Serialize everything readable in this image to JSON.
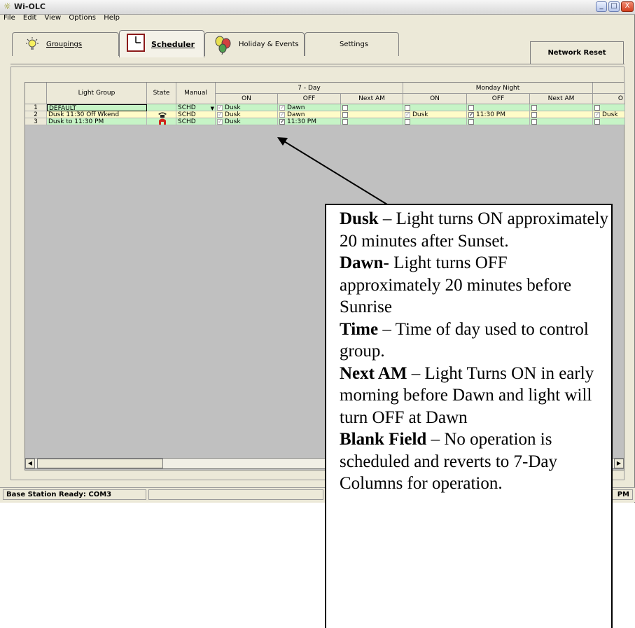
{
  "window": {
    "title": "Wi-OLC",
    "controls": {
      "minimize": "_",
      "maximize": "□",
      "close": "X"
    }
  },
  "menu": [
    "File",
    "Edit",
    "View",
    "Options",
    "Help"
  ],
  "tabs": [
    {
      "label": "Groupings",
      "icon": "bulb-icon",
      "active": false
    },
    {
      "label": "Scheduler",
      "icon": "clock-icon",
      "active": true
    },
    {
      "label": "Holiday & Events",
      "icon": "balloons-icon",
      "active": false
    },
    {
      "label": "Settings",
      "icon": "",
      "active": false
    }
  ],
  "network_reset_label": "Network Reset",
  "grid": {
    "headers": {
      "light_group": "Light Group",
      "state": "State",
      "manual": "Manual",
      "seven_day": "7 - Day",
      "monday_night": "Monday Night",
      "on": "ON",
      "off": "OFF",
      "next_am": "Next AM",
      "next_on_partial": "O"
    },
    "rows": [
      {
        "num": "1",
        "group": "DEFAULT",
        "state": "",
        "manual": "SCHD",
        "on7": "Dusk",
        "off7": "Dawn",
        "mon_on": "",
        "mon_off": "",
        "next_on": ""
      },
      {
        "num": "2",
        "group": "Dusk 11:30 Off Wkend",
        "state": "phone-icon",
        "manual": "SCHD",
        "on7": "Dusk",
        "off7": "Dawn",
        "mon_on": "Dusk",
        "mon_off": "11:30 PM",
        "next_on": "Dusk"
      },
      {
        "num": "3",
        "group": "Dusk to 11:30 PM",
        "state": "signal-icon",
        "manual": "SCHD",
        "on7": "Dusk",
        "off7": "11:30 PM",
        "mon_on": "",
        "mon_off": "",
        "next_on": ""
      }
    ]
  },
  "status": {
    "left": "Base Station Ready: COM3",
    "right": "PM"
  },
  "callout": {
    "dusk_term": "Dusk",
    "dusk_text": " – Light turns ON approximately 20 minutes after Sunset.",
    "dawn_term": "Dawn",
    "dawn_text": "- Light turns OFF approximately 20 minutes before Sunrise",
    "time_term": "Time",
    "time_text": " – Time of day used to control group.",
    "nextam_term": "Next AM",
    "nextam_text": " – Light Turns ON in early morning before Dawn and light will turn OFF at Dawn",
    "blank_term": "Blank Field",
    "blank_text": " – No operation is scheduled and reverts to 7-Day Columns for operation."
  }
}
